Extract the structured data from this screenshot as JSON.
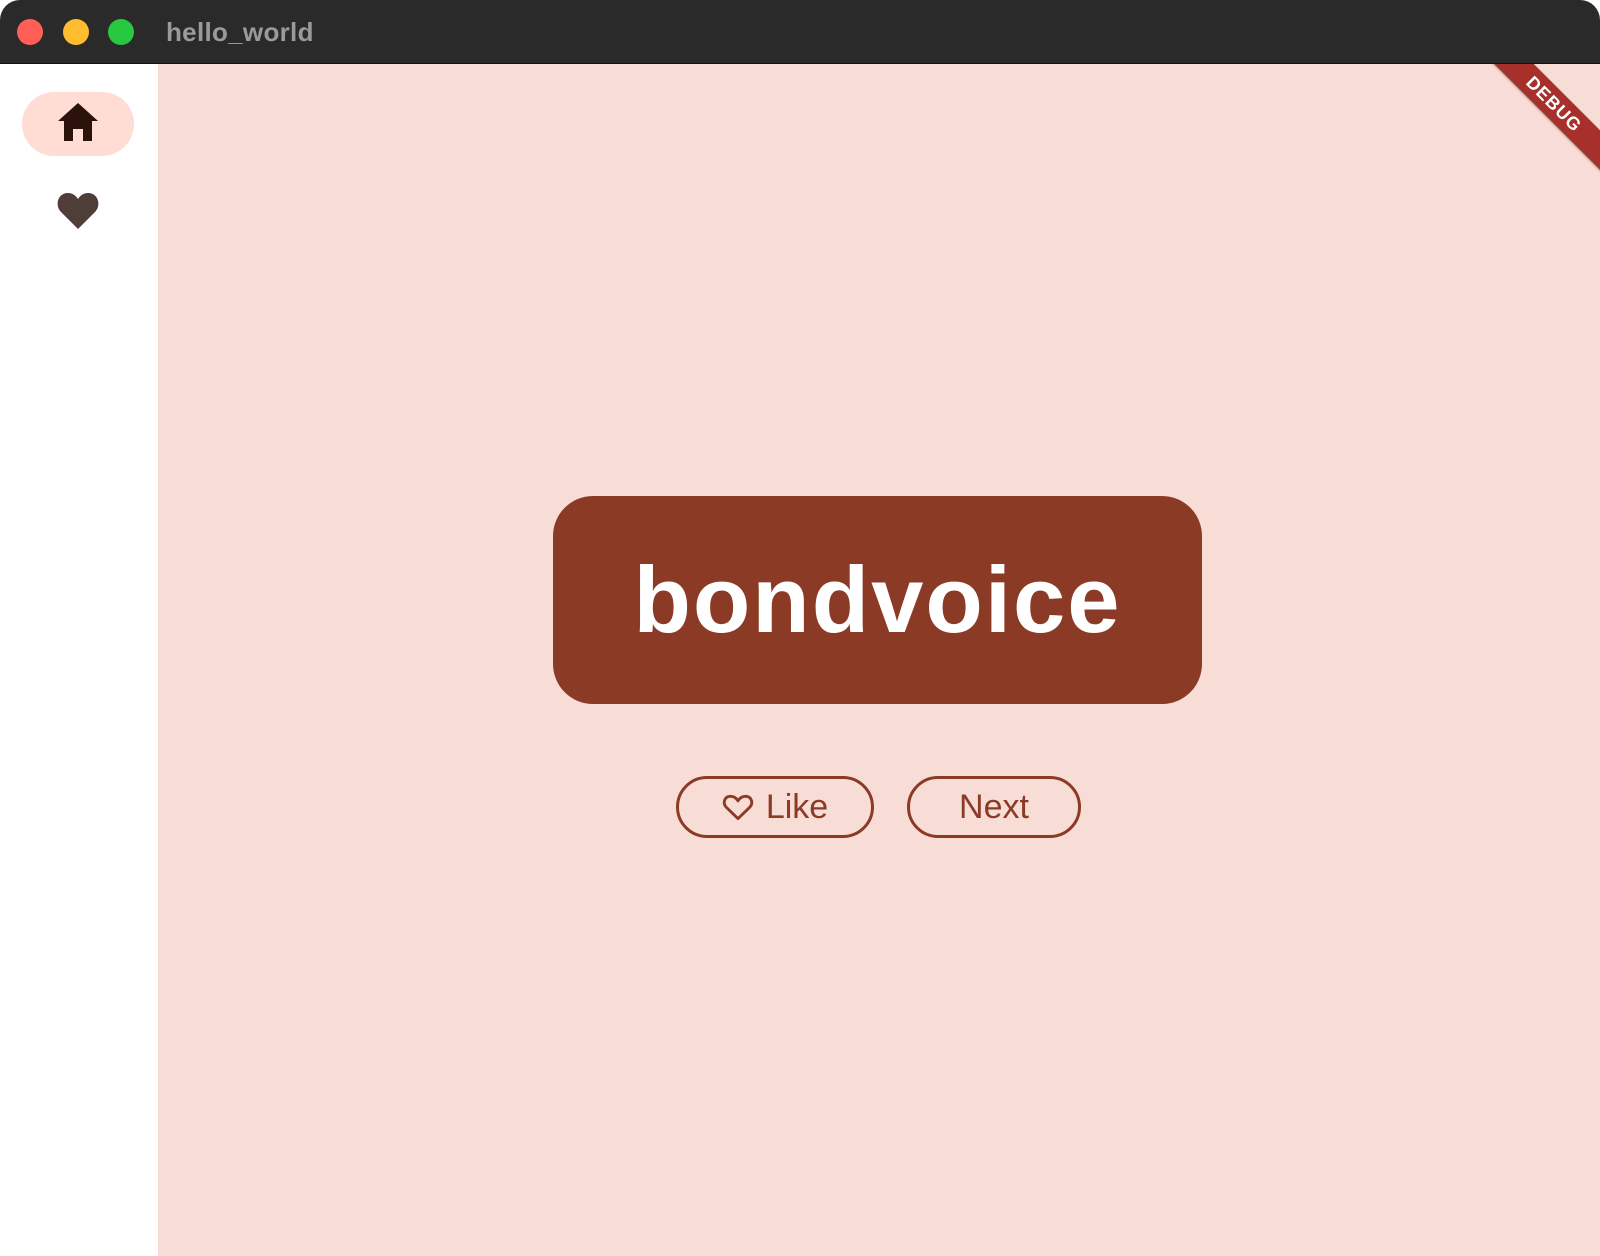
{
  "window": {
    "title": "hello_world"
  },
  "rail": {
    "items": [
      {
        "icon": "home-icon",
        "selected": true
      },
      {
        "icon": "heart-icon",
        "selected": false
      }
    ]
  },
  "main": {
    "word": "bondvoice",
    "like_label": "Like",
    "like_icon": "heart-outline-icon",
    "next_label": "Next",
    "debug_banner": "DEBUG"
  },
  "colors": {
    "accent": "#8b3a26",
    "background": "#f8ddd7",
    "selected_rail": "#ffdcd4",
    "titlebar": "#2a2a2a"
  }
}
